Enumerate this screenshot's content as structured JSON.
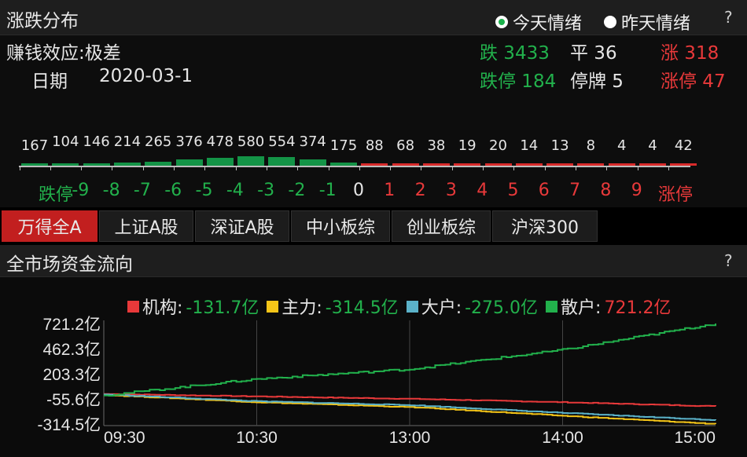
{
  "top_panel": {
    "title": "涨跌分布",
    "radio_today": "今天情绪",
    "radio_yesterday": "昨天情绪",
    "help": "?",
    "money_effect": "赚钱效应:极差",
    "date_label": "日期",
    "date_value": "2020-03-1",
    "stats": {
      "down": "跌 3433",
      "flat": "平 36",
      "up": "涨 318",
      "limit_down": "跌停 184",
      "suspended": "停牌 5",
      "limit_up": "涨停 47"
    },
    "distribution": {
      "labels": [
        "跌停",
        "-9",
        "-8",
        "-7",
        "-6",
        "-5",
        "-4",
        "-3",
        "-2",
        "-1",
        "0",
        "1",
        "2",
        "3",
        "4",
        "5",
        "6",
        "7",
        "8",
        "9",
        "涨停"
      ],
      "values": [
        "167",
        "104",
        "146",
        "214",
        "265",
        "376",
        "478",
        "580",
        "554",
        "374",
        "175",
        "88",
        "68",
        "38",
        "19",
        "20",
        "14",
        "13",
        "8",
        "4",
        "4",
        "42"
      ],
      "label_colors": [
        "#22b14c",
        "#22b14c",
        "#22b14c",
        "#22b14c",
        "#22b14c",
        "#22b14c",
        "#22b14c",
        "#22b14c",
        "#22b14c",
        "#22b14c",
        "#e6e6e6",
        "#e8393a",
        "#e8393a",
        "#e8393a",
        "#e8393a",
        "#e8393a",
        "#e8393a",
        "#e8393a",
        "#e8393a",
        "#e8393a",
        "#e8393a"
      ]
    }
  },
  "tabs": [
    "万得全A",
    "上证A股",
    "深证A股",
    "中小板综",
    "创业板综",
    "沪深300"
  ],
  "active_tab": 0,
  "bottom_panel": {
    "title": "全市场资金流向",
    "help": "?",
    "legend": [
      {
        "name": "机构:",
        "value": "-131.7亿",
        "color": "#e8393a",
        "value_color": "#22b14c"
      },
      {
        "name": "主力:",
        "value": "-314.5亿",
        "color": "#f5c518",
        "value_color": "#22b14c"
      },
      {
        "name": "大户:",
        "value": "-275.0亿",
        "color": "#5bb2c9",
        "value_color": "#22b14c"
      },
      {
        "name": "散户:",
        "value": "721.2亿",
        "color": "#22b14c",
        "value_color": "#e8393a"
      }
    ],
    "y_ticks": [
      "721.2亿",
      "462.3亿",
      "203.3亿",
      "-55.6亿",
      "-314.5亿"
    ],
    "x_ticks": [
      "09:30",
      "10:30",
      "13:00",
      "14:00",
      "15:00"
    ]
  },
  "chart_data": {
    "type": "line",
    "title": "全市场资金流向",
    "x": [
      "09:30",
      "10:30",
      "13:00",
      "14:00",
      "15:00"
    ],
    "ylim": [
      -314.5,
      721.2
    ],
    "y_ticks": [
      721.2,
      462.3,
      203.3,
      -55.6,
      -314.5
    ],
    "series": [
      {
        "name": "机构",
        "color": "#e8393a",
        "values": [
          -5,
          -30,
          -55,
          -90,
          -131.7
        ]
      },
      {
        "name": "主力",
        "color": "#f5c518",
        "values": [
          -15,
          -90,
          -140,
          -230,
          -314.5
        ]
      },
      {
        "name": "大户",
        "color": "#5bb2c9",
        "values": [
          -10,
          -80,
          -120,
          -200,
          -275.0
        ]
      },
      {
        "name": "散户",
        "color": "#22b14c",
        "values": [
          -20,
          150,
          250,
          450,
          721.2
        ]
      }
    ]
  }
}
